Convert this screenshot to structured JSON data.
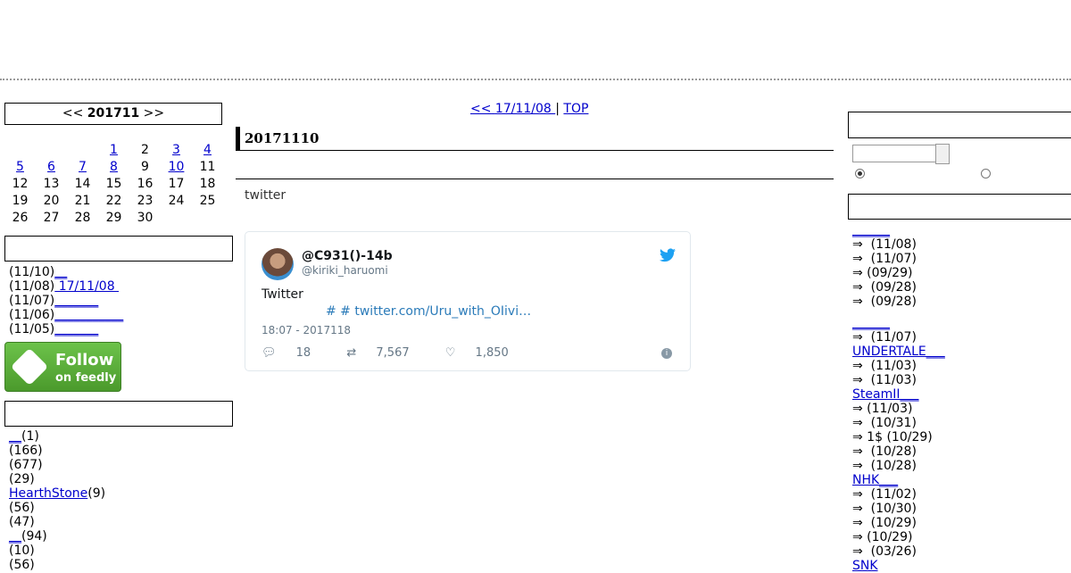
{
  "calendar": {
    "prev": "<<",
    "month": "201711",
    "next": ">>",
    "rows": [
      [
        "",
        "",
        "",
        "1",
        "2",
        "3",
        "4"
      ],
      [
        "5",
        "6",
        "7",
        "8",
        "9",
        "10",
        "11"
      ],
      [
        "12",
        "13",
        "14",
        "15",
        "16",
        "17",
        "18"
      ],
      [
        "19",
        "20",
        "21",
        "22",
        "23",
        "24",
        "25"
      ],
      [
        "26",
        "27",
        "28",
        "29",
        "30",
        "",
        ""
      ]
    ],
    "linked_days": [
      "1",
      "3",
      "4",
      "5",
      "6",
      "7",
      "8",
      "10"
    ]
  },
  "recent_entries": [
    {
      "date": "(11/10)",
      "title": "__"
    },
    {
      "date": "(11/08)",
      "title": " 17/11/08 "
    },
    {
      "date": "(11/07)",
      "title": "_______"
    },
    {
      "date": "(11/06)",
      "title": "___________"
    },
    {
      "date": "(11/05)",
      "title": "_______"
    }
  ],
  "feedly": {
    "line1": "Follow",
    "line2": "on feedly"
  },
  "categories": [
    {
      "name": "__",
      "count": "(1)",
      "link": true
    },
    {
      "name": "",
      "count": "(166)",
      "link": false
    },
    {
      "name": "",
      "count": "(677)",
      "link": false
    },
    {
      "name": "",
      "count": "(29)",
      "link": false
    },
    {
      "name": "HearthStone",
      "count": "(9)",
      "link": true
    },
    {
      "name": "",
      "count": "(56)",
      "link": false
    },
    {
      "name": "",
      "count": "(47)",
      "link": false
    },
    {
      "name": "__",
      "count": "(94)",
      "link": true
    },
    {
      "name": "",
      "count": "(10)",
      "link": false
    },
    {
      "name": "",
      "count": "(56)",
      "link": false
    }
  ],
  "nav": {
    "prev": "<<",
    "prev_title": " 17/11/08 ",
    "sep": " | ",
    "top": "TOP"
  },
  "entry": {
    "title": "20171110",
    "body": "twitter"
  },
  "tweet": {
    "name": "@C931()-14b",
    "handle": "@kiriki_haruomi",
    "text": "Twitter",
    "link": "# # twitter.com/Uru_with_OIivi…",
    "time": "18:07 - 2017118",
    "replies": "18",
    "retweets": "7,567",
    "likes": "1,850"
  },
  "right_groups": [
    {
      "head": "______",
      "items": [
        "⇒  (11/08)",
        "⇒  (11/07)",
        "⇒ (09/29)",
        "⇒  (09/28)",
        "⇒  (09/28)"
      ]
    },
    {
      "head": "______",
      "items": [
        "⇒  (11/07)"
      ]
    },
    {
      "head": "UNDERTALE___",
      "items": [
        "⇒  (11/03)",
        "⇒  (11/03)"
      ]
    },
    {
      "head": "SteamII___",
      "items": [
        "⇒ (11/03)",
        "⇒  (10/31)",
        "⇒ 1$ (10/29)",
        "⇒  (10/28)",
        "⇒  (10/28)"
      ]
    },
    {
      "head": "NHK___",
      "items": [
        "⇒  (11/02)",
        "⇒  (10/30)",
        "⇒  (10/29)",
        "⇒ (10/29)",
        "⇒  (03/26)"
      ]
    },
    {
      "head": "SNK",
      "items": []
    }
  ],
  "colors": {
    "link": "#0000cc",
    "twitter_blue": "#1da1f2",
    "feedly_green": "#6cc24a"
  }
}
